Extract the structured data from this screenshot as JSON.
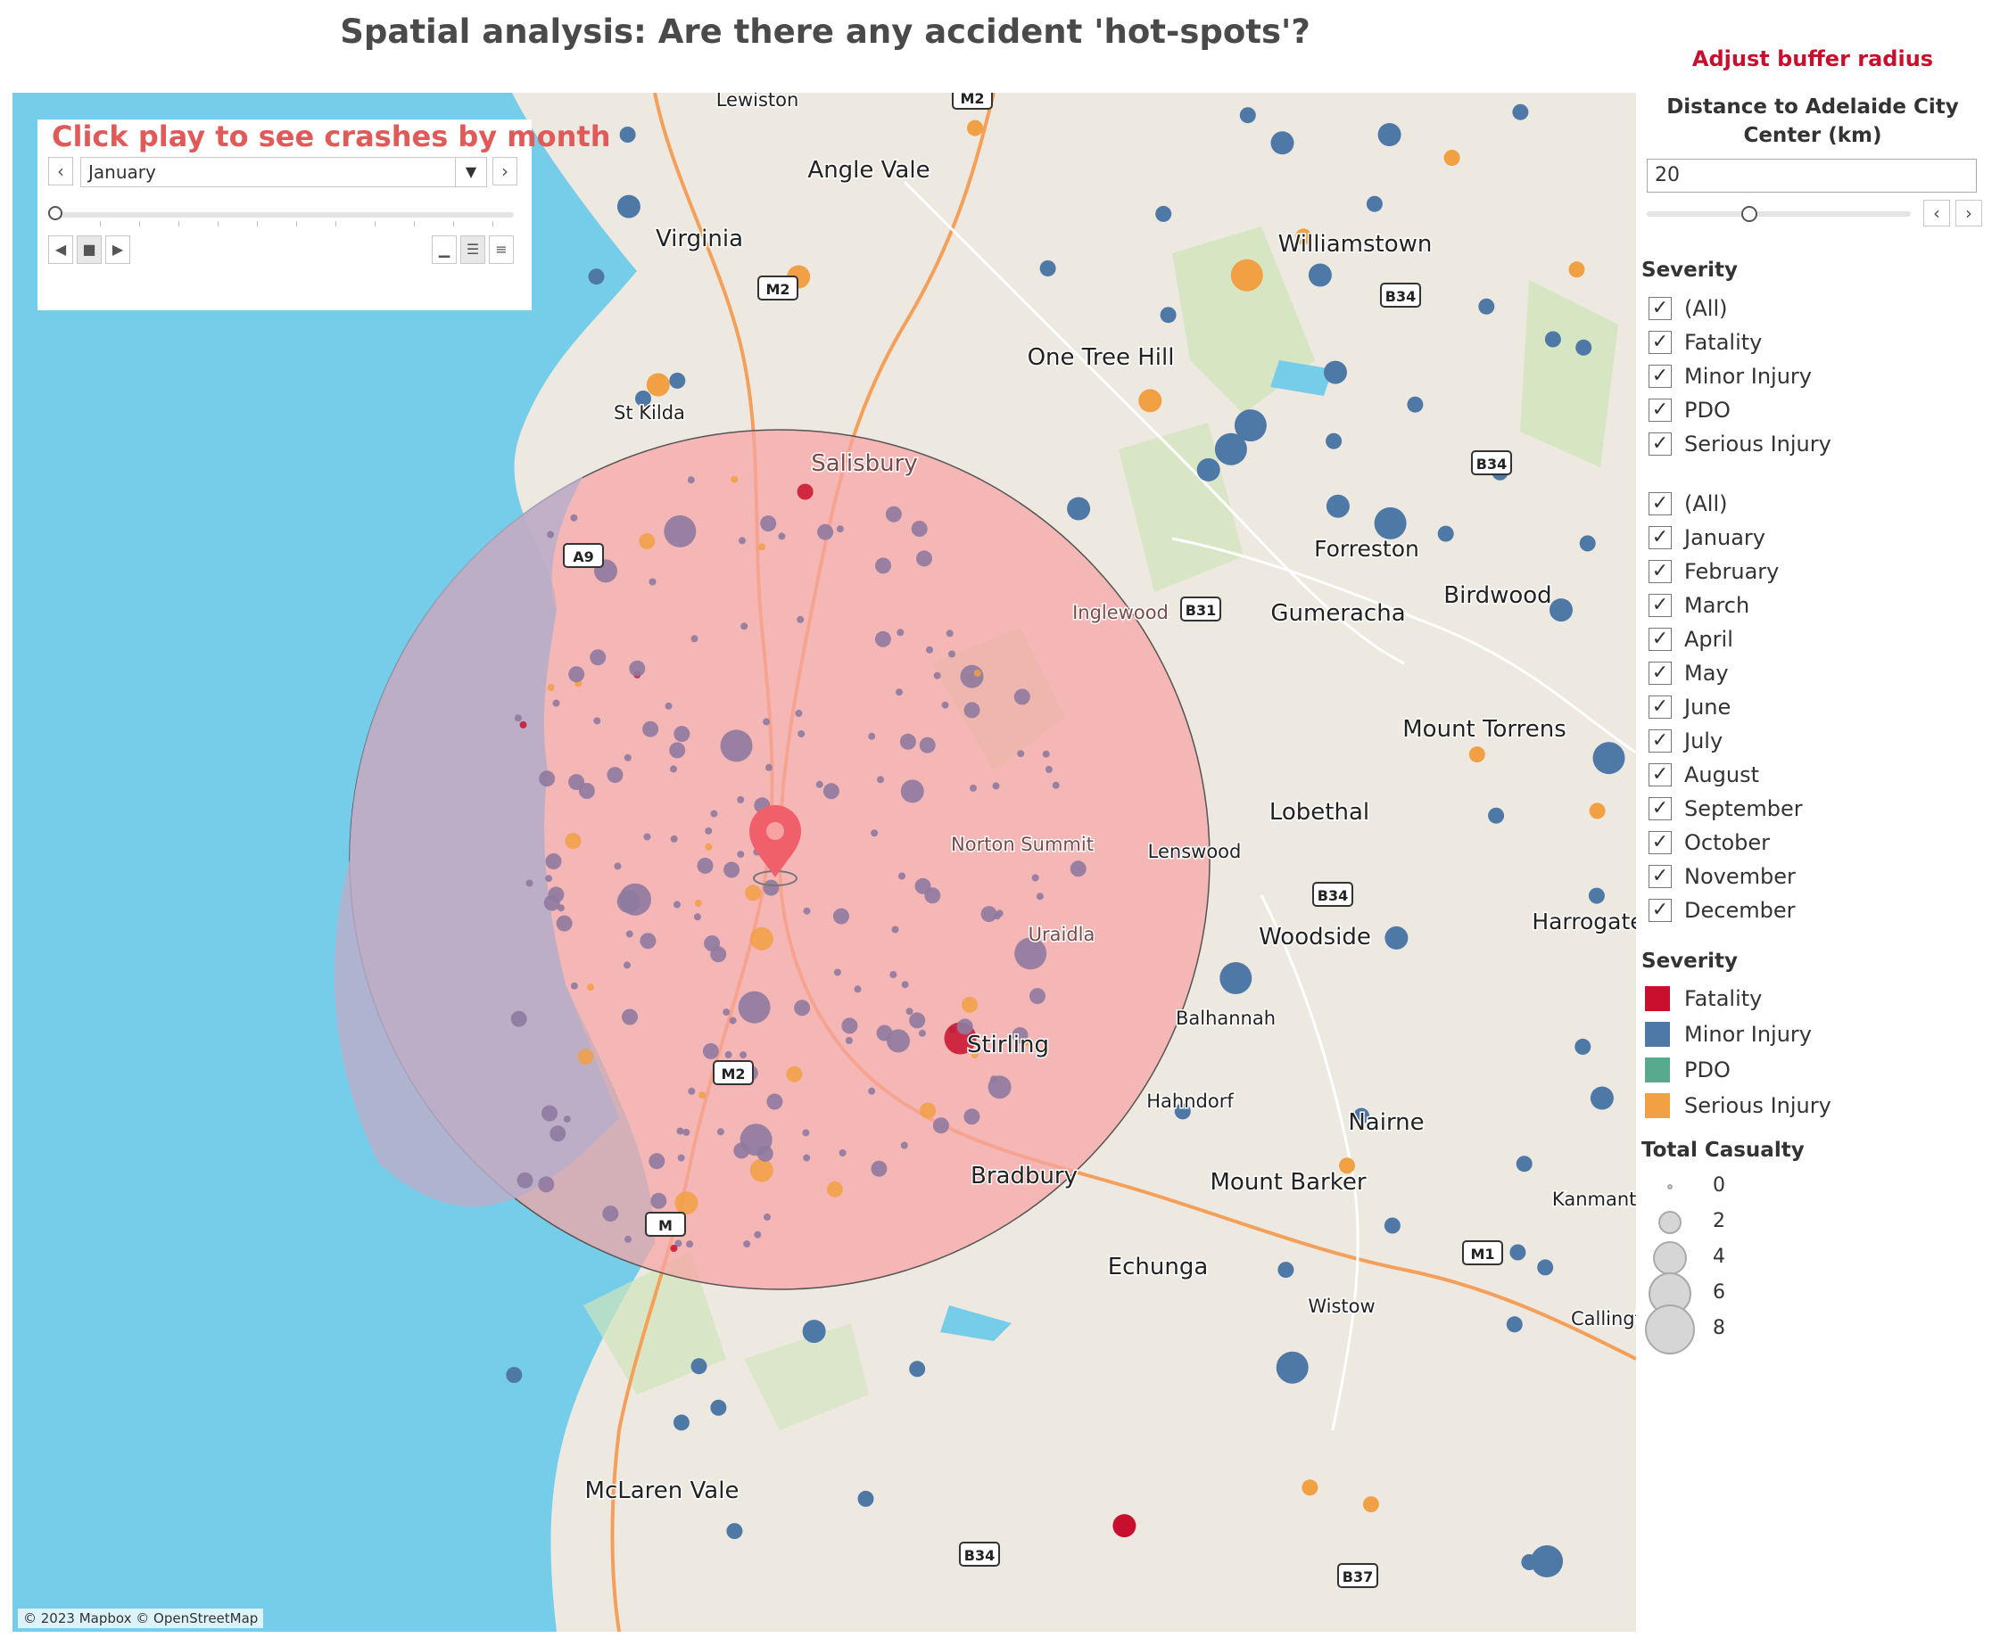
{
  "title": "Spatial analysis: Are there any accident 'hot-spots'?",
  "player": {
    "title": "Click play to see crashes by month",
    "selected_month": "January"
  },
  "buffer": {
    "heading": "Adjust buffer radius",
    "label": "Distance to Adelaide City Center (km)",
    "value": "20",
    "value_numeric": 20
  },
  "severity_filter": {
    "label": "Severity",
    "items": [
      "(All)",
      "Fatality",
      "Minor Injury",
      "PDO",
      "Serious Injury"
    ]
  },
  "month_filter": {
    "items": [
      "(All)",
      "January",
      "February",
      "March",
      "April",
      "May",
      "June",
      "July",
      "August",
      "September",
      "October",
      "November",
      "December"
    ]
  },
  "severity_legend": {
    "label": "Severity",
    "items": [
      {
        "label": "Fatality",
        "color": "#c8102e"
      },
      {
        "label": "Minor Injury",
        "color": "#4e79a7"
      },
      {
        "label": "PDO",
        "color": "#59a98e"
      },
      {
        "label": "Serious Injury",
        "color": "#f1a043"
      }
    ]
  },
  "casualty_legend": {
    "label": "Total Casualty",
    "items": [
      "0",
      "2",
      "4",
      "6",
      "8"
    ]
  },
  "map": {
    "attribution": "© 2023 Mapbox © OpenStreetMap",
    "colors": {
      "water": "#76cdea",
      "land": "#ede8e0",
      "buffer": "#f7a3a3",
      "road": "#f5a05a",
      "park": "#cfe5bb",
      "purple_overlap": "#9b87a8",
      "pin": "#f0606a"
    },
    "places": [
      "Lewiston",
      "Angle Vale",
      "Virginia",
      "Williamstown",
      "One Tree Hill",
      "St Kilda",
      "Salisbury",
      "Forreston",
      "Inglewood",
      "Gumeracha",
      "Birdwood",
      "Mount Torrens",
      "Lobethal",
      "Lenswood",
      "Norton Summit",
      "Woodside",
      "Harrogate",
      "Uraidla",
      "Stirling",
      "Balhannah",
      "Hahndorf",
      "Nairne",
      "Bradbury",
      "Mount Barker",
      "Kanmantoo",
      "Echunga",
      "Wistow",
      "McLaren Vale",
      "Callington"
    ],
    "road_shields": [
      "M2",
      "M2",
      "B34",
      "B34",
      "A9",
      "B34",
      "M1",
      "B34",
      "B37",
      "M2",
      "M",
      "B31"
    ]
  }
}
